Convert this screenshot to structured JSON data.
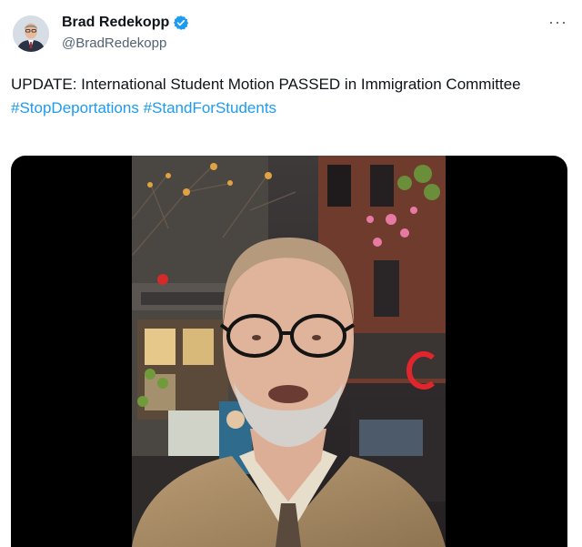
{
  "author": {
    "name": "Brad Redekopp",
    "handle": "@BradRedekopp",
    "verified_icon": "verified-badge-icon",
    "avatar_icon": "profile-photo"
  },
  "tweet": {
    "text": "UPDATE: International Student Motion PASSED in Immigration Committee",
    "hashtags": [
      "#StopDeportations",
      "#StandForStudents"
    ]
  },
  "menu": {
    "label": "···",
    "icon": "more-options-icon"
  },
  "media": {
    "type": "video",
    "icon": "video-frame"
  },
  "colors": {
    "link": "#1d9bf0",
    "verified": "#1d9bf0",
    "secondary_text": "#536471"
  }
}
